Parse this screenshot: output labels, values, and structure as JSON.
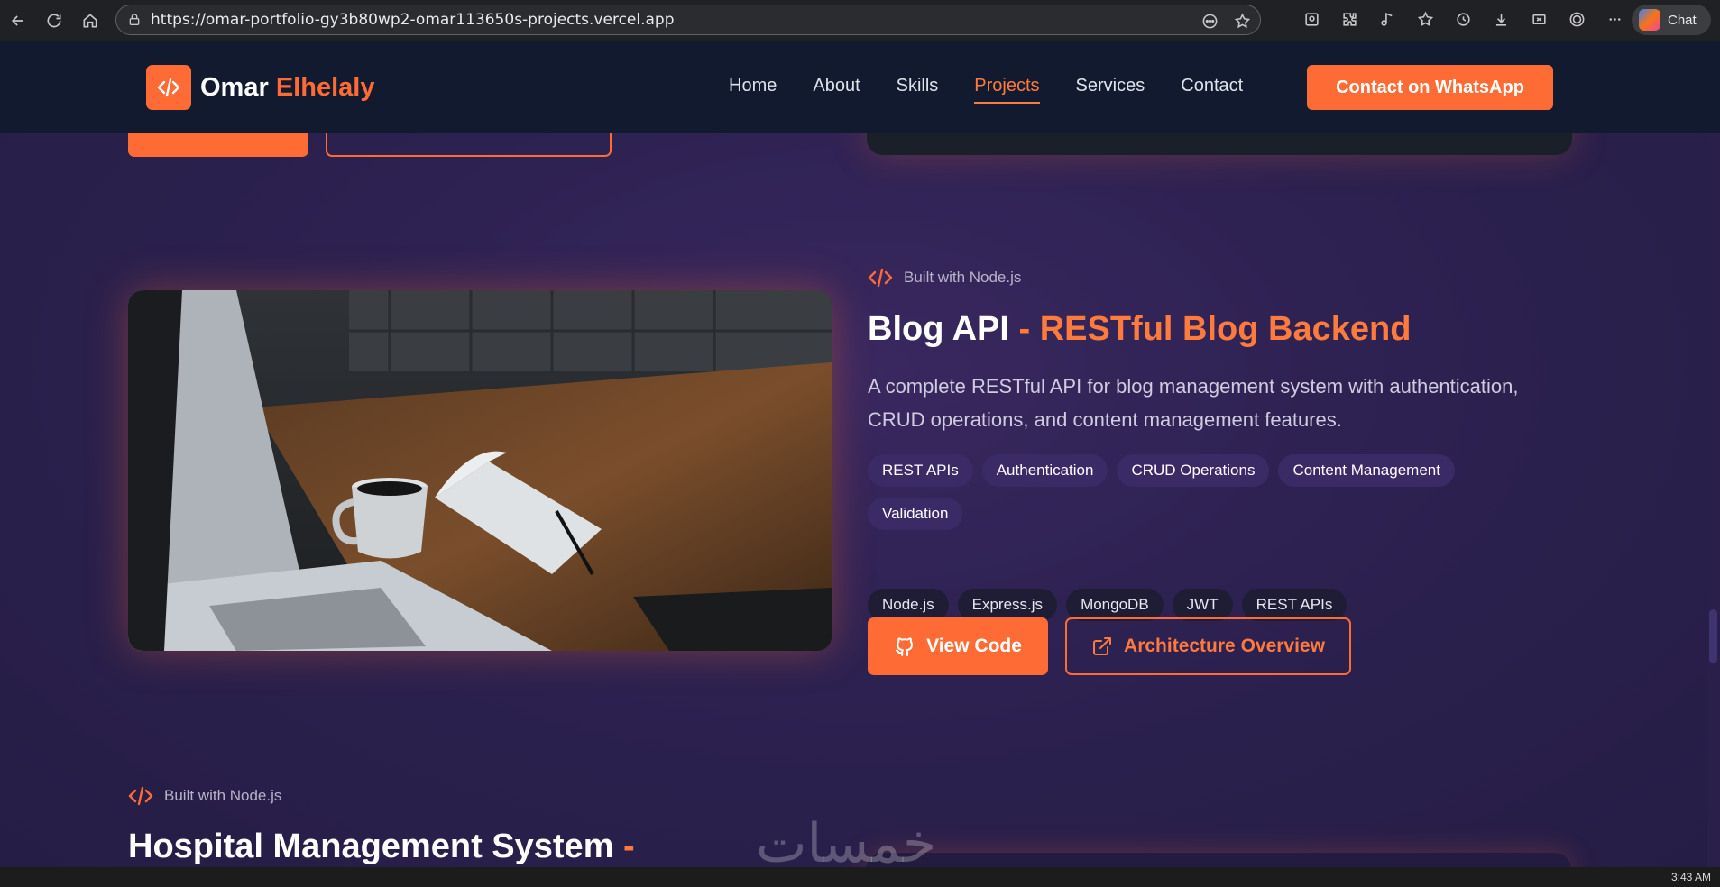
{
  "browser": {
    "url": "https://omar-portfolio-gy3b80wp2-omar113650s-projects.vercel.app",
    "chat_label": "Chat",
    "icons": [
      "back-icon",
      "refresh-icon",
      "home-icon",
      "lock-icon",
      "reader-icon",
      "star-icon",
      "profile-icon",
      "extensions-icon",
      "media-icon",
      "favorites-icon",
      "history-icon",
      "download-icon",
      "screenshot-icon",
      "copilot-icon",
      "more-icon"
    ]
  },
  "site": {
    "brand_first": "Omar",
    "brand_last": "Elhelaly",
    "nav": [
      "Home",
      "About",
      "Skills",
      "Projects",
      "Services",
      "Contact"
    ],
    "active_nav": "Projects",
    "whatsapp_label": "Contact on WhatsApp"
  },
  "project": {
    "built_with": "Built with Node.js",
    "title_main": "Blog API",
    "title_accent": " - RESTful Blog Backend",
    "description": "A complete RESTful API for blog management system with authentication, CRUD operations, and content management features.",
    "tags": [
      "REST APIs",
      "Authentication",
      "CRUD Operations",
      "Content Management",
      "Validation"
    ],
    "techs": [
      "Node.js",
      "Express.js",
      "MongoDB",
      "JWT",
      "REST APIs"
    ],
    "view_code_label": "View Code",
    "architecture_label": "Architecture Overview"
  },
  "next_project": {
    "built_with": "Built with Node.js",
    "title_main": "Hospital Management System",
    "title_accent": " -"
  },
  "taskbar": {
    "time": "3:43 AM"
  },
  "watermark": "خمسات",
  "colors": {
    "accent": "#ff6b35",
    "header_bg": "#121a30",
    "page_bg": "#2c2150"
  }
}
